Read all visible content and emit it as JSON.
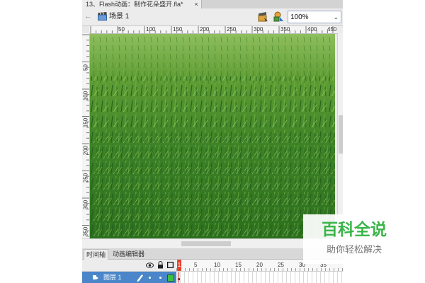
{
  "document_tab": {
    "title": "13、Flash动画：制作花朵盛开.fla*",
    "close": "×"
  },
  "editbar": {
    "back": "←",
    "scene_label": "场景 1",
    "zoom_value": "100%",
    "zoom_arrow": "⌄"
  },
  "ruler": {
    "horizontal": [
      "50",
      "100",
      "150",
      "200",
      "250",
      "300",
      "350",
      "400",
      "450"
    ],
    "vertical": [
      "50",
      "100",
      "150",
      "200",
      "250",
      "300",
      "350"
    ]
  },
  "panel_tabs": {
    "timeline": "时间轴",
    "motion_editor": "动画编辑器"
  },
  "timeline": {
    "playhead_frame": "1",
    "frame_numbers": [
      "5",
      "10",
      "15",
      "20",
      "25",
      "30",
      "35"
    ],
    "layer_name": "图层 1",
    "header_icons": [
      "eye-icon",
      "lock-icon",
      "outline-square-icon"
    ]
  },
  "colors": {
    "ui_background": "#ececec",
    "layer_highlight": "#4a86c9",
    "playhead": "#e6432c",
    "watermark_green": "#3bb54a"
  },
  "watermark": {
    "title": "百科全说",
    "subtitle": "助你轻松解决"
  }
}
